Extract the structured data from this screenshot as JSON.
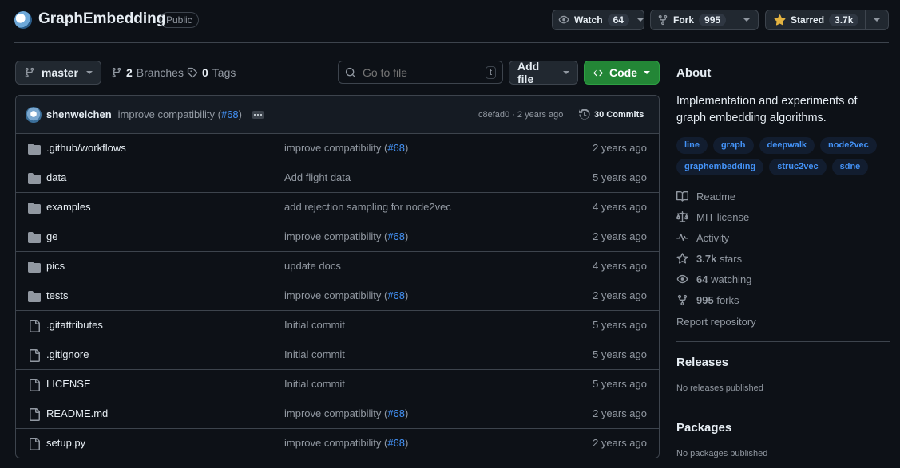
{
  "repo": {
    "name": "GraphEmbedding",
    "visibility": "Public"
  },
  "header_actions": {
    "watch_label": "Watch",
    "watch_count": "64",
    "fork_label": "Fork",
    "fork_count": "995",
    "star_label": "Starred",
    "star_count": "3.7k"
  },
  "toolbar": {
    "branch": "master",
    "branches_count": "2",
    "branches_label": "Branches",
    "tags_count": "0",
    "tags_label": "Tags",
    "go_to_file_placeholder": "Go to file",
    "go_to_file_shortcut": "t",
    "add_file_label": "Add file",
    "code_label": "Code"
  },
  "latest_commit": {
    "author": "shenweichen",
    "message_prefix": "improve compatibility (",
    "pr": "#68",
    "message_suffix": ")",
    "hash_and_time": "c8efad0 · 2 years ago",
    "commits_label": "30 Commits"
  },
  "files": [
    {
      "type": "dir",
      "name": ".github/workflows",
      "msg_prefix": "improve compatibility (",
      "pr": "#68",
      "msg_suffix": ")",
      "age": "2 years ago"
    },
    {
      "type": "dir",
      "name": "data",
      "msg_prefix": "Add flight data",
      "pr": "",
      "msg_suffix": "",
      "age": "5 years ago"
    },
    {
      "type": "dir",
      "name": "examples",
      "msg_prefix": "add rejection sampling for node2vec",
      "pr": "",
      "msg_suffix": "",
      "age": "4 years ago"
    },
    {
      "type": "dir",
      "name": "ge",
      "msg_prefix": "improve compatibility (",
      "pr": "#68",
      "msg_suffix": ")",
      "age": "2 years ago"
    },
    {
      "type": "dir",
      "name": "pics",
      "msg_prefix": "update docs",
      "pr": "",
      "msg_suffix": "",
      "age": "4 years ago"
    },
    {
      "type": "dir",
      "name": "tests",
      "msg_prefix": "improve compatibility (",
      "pr": "#68",
      "msg_suffix": ")",
      "age": "2 years ago"
    },
    {
      "type": "file",
      "name": ".gitattributes",
      "msg_prefix": "Initial commit",
      "pr": "",
      "msg_suffix": "",
      "age": "5 years ago"
    },
    {
      "type": "file",
      "name": ".gitignore",
      "msg_prefix": "Initial commit",
      "pr": "",
      "msg_suffix": "",
      "age": "5 years ago"
    },
    {
      "type": "file",
      "name": "LICENSE",
      "msg_prefix": "Initial commit",
      "pr": "",
      "msg_suffix": "",
      "age": "5 years ago"
    },
    {
      "type": "file",
      "name": "README.md",
      "msg_prefix": "improve compatibility (",
      "pr": "#68",
      "msg_suffix": ")",
      "age": "2 years ago"
    },
    {
      "type": "file",
      "name": "setup.py",
      "msg_prefix": "improve compatibility (",
      "pr": "#68",
      "msg_suffix": ")",
      "age": "2 years ago"
    }
  ],
  "about": {
    "heading": "About",
    "description": "Implementation and experiments of graph embedding algorithms.",
    "topics": [
      "line",
      "graph",
      "deepwalk",
      "node2vec",
      "graphembedding",
      "struc2vec",
      "sdne"
    ],
    "readme": "Readme",
    "license": "MIT license",
    "activity": "Activity",
    "stars_count": "3.7k",
    "stars_label": "stars",
    "watching_count": "64",
    "watching_label": "watching",
    "forks_count": "995",
    "forks_label": "forks",
    "report": "Report repository"
  },
  "releases": {
    "heading": "Releases",
    "note": "No releases published"
  },
  "packages": {
    "heading": "Packages",
    "note": "No packages published"
  },
  "colors": {
    "background": "#0d1117",
    "accent_green": "#238636",
    "link_blue": "#4493f8",
    "star_gold": "#e3b341"
  }
}
